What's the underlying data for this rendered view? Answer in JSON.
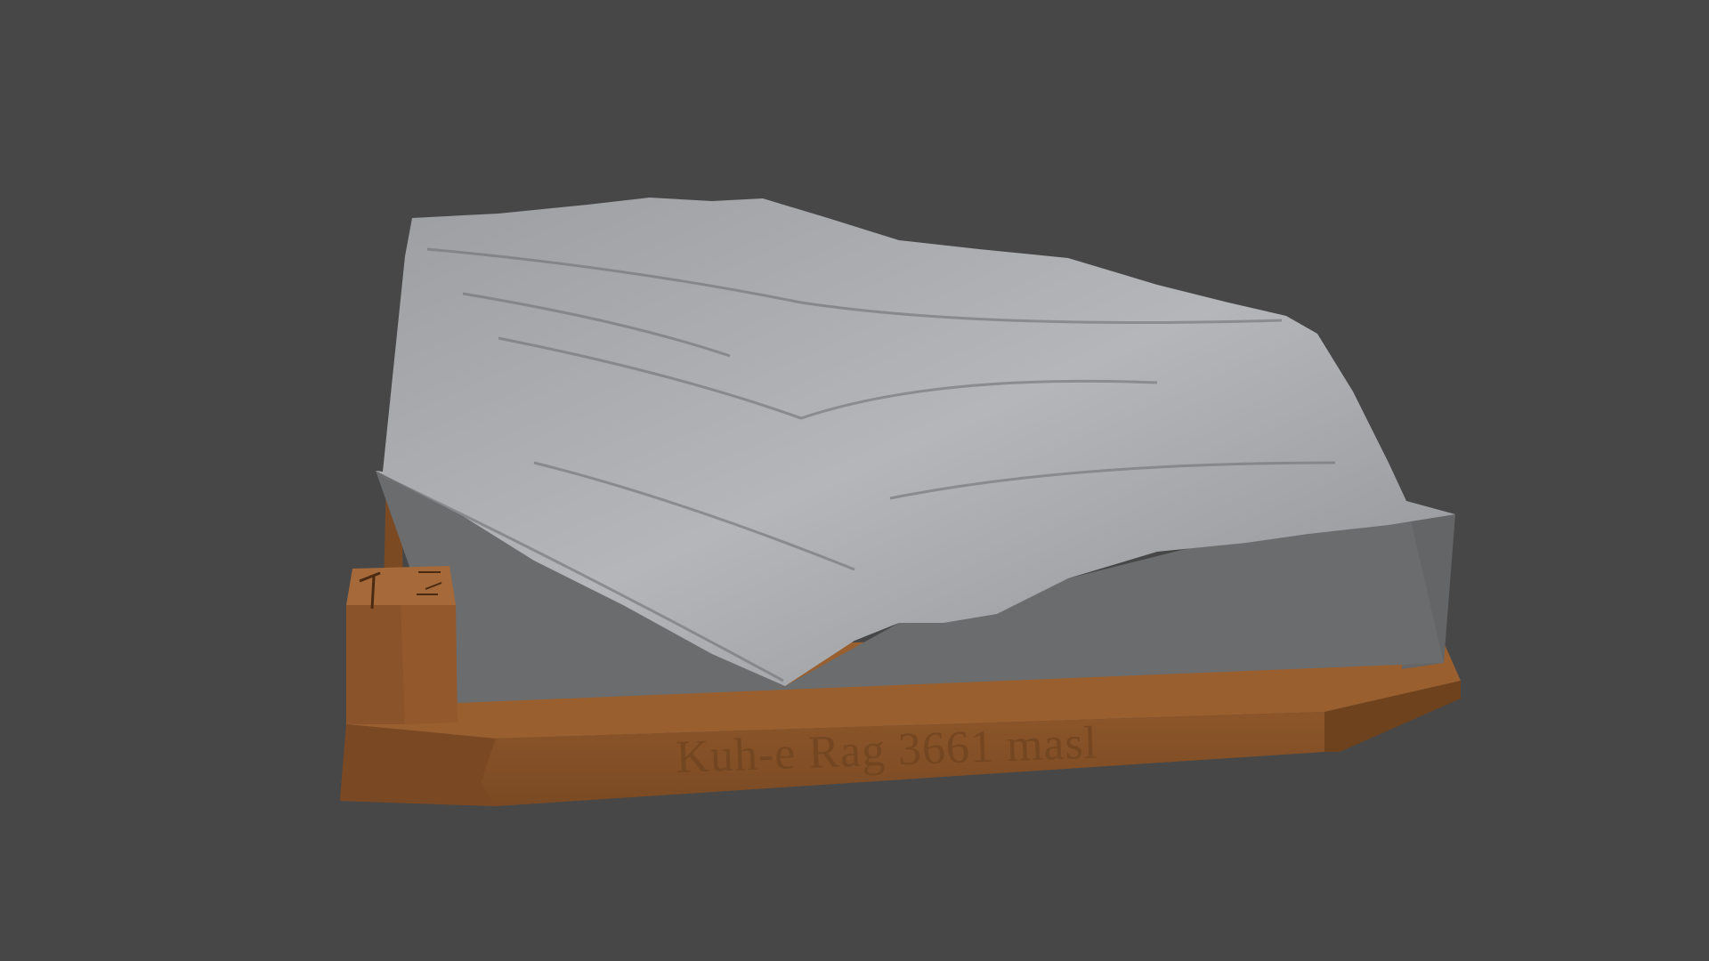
{
  "scene": {
    "model_label": "Kuh-e Rag 3661 masl",
    "colors": {
      "background": "#474747",
      "terrain": "#a9abae",
      "terrain_side": "#6b6c6d",
      "base": "#8a552a",
      "base_dark": "#6a4020"
    },
    "icons": [
      "hammer-icon",
      "scale-icon"
    ]
  }
}
